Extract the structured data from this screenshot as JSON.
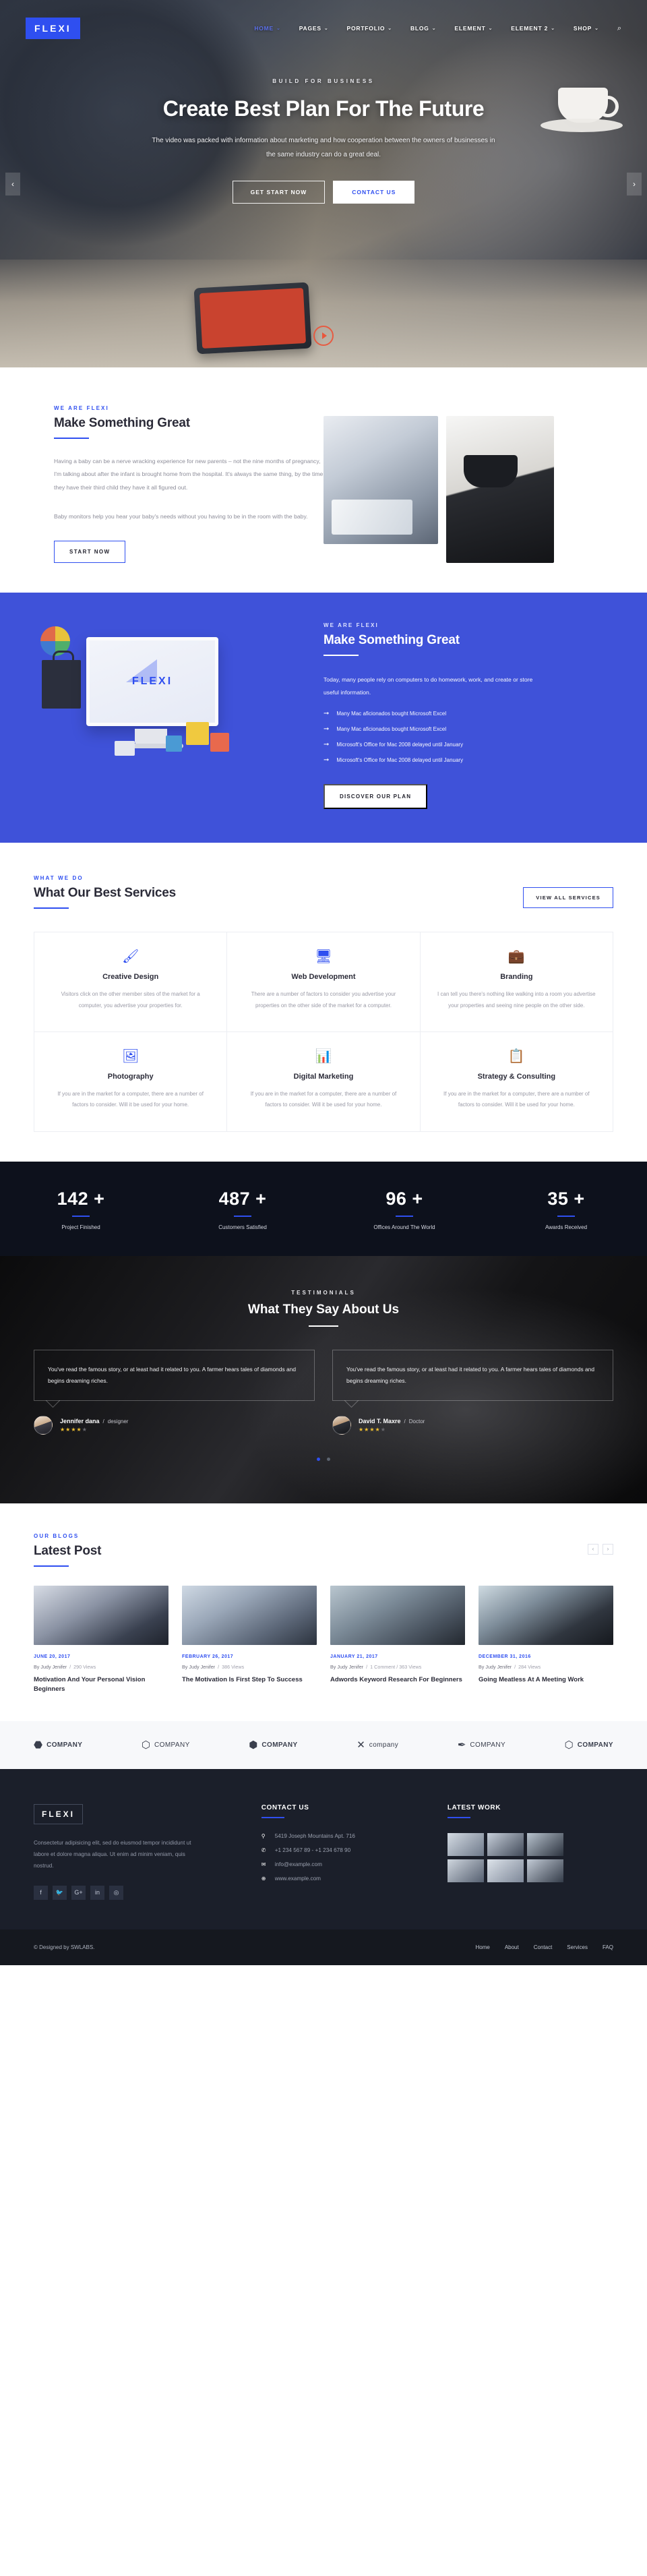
{
  "nav": {
    "logo": "FLEXI",
    "items": [
      {
        "label": "HOME",
        "caret": "⌄",
        "active": true
      },
      {
        "label": "PAGES",
        "caret": "⌄"
      },
      {
        "label": "PORTFOLIO",
        "caret": "⌄"
      },
      {
        "label": "BLOG",
        "caret": "⌄"
      },
      {
        "label": "ELEMENT",
        "caret": "⌄"
      },
      {
        "label": "ELEMENT 2",
        "caret": "⌄"
      },
      {
        "label": "SHOP",
        "caret": "⌄"
      }
    ],
    "search_icon": "⌕"
  },
  "hero": {
    "eyebrow": "BUILD FOR BUSINESS",
    "title": "Create Best Plan For The Future",
    "subtitle": "The video was packed with information about marketing and how cooperation between the owners of businesses in the same industry can do a great deal.",
    "btn_primary": "GET START NOW",
    "btn_secondary": "CONTACT US",
    "arrow_left": "‹",
    "arrow_right": "›"
  },
  "about": {
    "eyebrow": "WE ARE FLEXI",
    "title": "Make Something Great",
    "paragraph1": "Having a baby can be a nerve wracking experience for new parents – not the nine months of pregnancy, I'm talking about after the infant is brought home from the hospital. It's always the same thing, by the time they have their third child they have it all figured out.",
    "paragraph2": "Baby monitors help you hear your baby's needs without you having to be in the room with the baby.",
    "button": "START NOW"
  },
  "blue": {
    "eyebrow": "WE ARE FLEXI",
    "title": "Make Something Great",
    "paragraph": "Today, many people rely on computers to do homework, work, and create or store useful information.",
    "monitor_logo": "FLEXI",
    "list": [
      "Many Mac aficionados bought Microsoft Excel",
      "Many Mac aficionados bought Microsoft Excel",
      "Microsoft's Office for Mac 2008 delayed until January",
      "Microsoft's Office for Mac 2008 delayed until January"
    ],
    "arrow": "➞",
    "button": "DISCOVER OUR PLAN"
  },
  "services": {
    "eyebrow": "WHAT WE DO",
    "title": "What Our Best Services",
    "view_all": "VIEW ALL SERVICES",
    "cards": [
      {
        "icon": "🖌",
        "icon_name": "paint-brush-icon",
        "name": "Creative Design",
        "desc": "Visitors click on the other member sites of the market for a computer, you advertise your properties for."
      },
      {
        "icon": "🖥",
        "icon_name": "monitor-icon",
        "name": "Web Development",
        "desc": "There are a number of factors to consider you advertise your properties on the other side of the market for a computer."
      },
      {
        "icon": "💼",
        "icon_name": "briefcase-icon",
        "name": "Branding",
        "desc": "I can tell you there's nothing like walking into a room you advertise your properties and seeing nine people on the other side."
      },
      {
        "icon": "🖼",
        "icon_name": "photo-stack-icon",
        "name": "Photography",
        "desc": "If you are in the market for a computer, there are a number of factors to consider. Will it be used for your home."
      },
      {
        "icon": "📊",
        "icon_name": "bar-chart-icon",
        "name": "Digital Marketing",
        "desc": "If you are in the market for a computer, there are a number of factors to consider. Will it be used for your home."
      },
      {
        "icon": "📋",
        "icon_name": "clipboard-icon",
        "name": "Strategy & Consulting",
        "desc": "If you are in the market for a computer, there are a number of factors to consider. Will it be used for your home."
      }
    ]
  },
  "counters": [
    {
      "value": "142 +",
      "label": "Project Finished"
    },
    {
      "value": "487 +",
      "label": "Customers Satisfied"
    },
    {
      "value": "96 +",
      "label": "Offices Around The World"
    },
    {
      "value": "35 +",
      "label": "Awards Received"
    }
  ],
  "testimonials": {
    "eyebrow": "TESTIMONIALS",
    "title": "What They Say About Us",
    "items": [
      {
        "quote": "You've read the famous story, or at least had it related to you. A farmer hears tales of diamonds and begins dreaming riches.",
        "name": "Jennifer dana",
        "separator": "/",
        "role": "designer",
        "rating": "★★★★",
        "rating_off": "★"
      },
      {
        "quote": "You've read the famous story, or at least had it related to you. A farmer hears tales of diamonds and begins dreaming riches.",
        "name": "David T. Maxre",
        "separator": "/",
        "role": "Doctor",
        "rating": "★★★★",
        "rating_off": "★"
      }
    ]
  },
  "blog": {
    "eyebrow": "OUR BLOGS",
    "title": "Latest Post",
    "prev": "‹",
    "next": "›",
    "posts": [
      {
        "date": "JUNE 20, 2017",
        "author": "By Judy Jenifer",
        "meta": "290 Views",
        "title": "Motivation And Your Personal Vision Beginners"
      },
      {
        "date": "FEBRUARY 26, 2017",
        "author": "By Judy Jenifer",
        "meta": "386 Views",
        "title": "The Motivation Is First Step To Success"
      },
      {
        "date": "JANUARY 21, 2017",
        "author": "By Judy Jenifer",
        "meta": "1 Comment  /  363 Views",
        "title": "Adwords Keyword Research For Beginners"
      },
      {
        "date": "DECEMBER 31, 2016",
        "author": "By Judy Jenifer",
        "meta": "284 Views",
        "title": "Going Meatless At A Meeting Work"
      }
    ]
  },
  "brands": [
    {
      "mark": "⬣",
      "name": "COMPANY",
      "thin": false
    },
    {
      "mark": "⬡",
      "name": "COMPANY",
      "thin": true
    },
    {
      "mark": "⬢",
      "name": "COMPANY",
      "thin": false
    },
    {
      "mark": "✕",
      "name": "company",
      "thin": true
    },
    {
      "mark": "✒",
      "name": "COMPANY",
      "thin": true
    },
    {
      "mark": "⬡",
      "name": "COMPANY",
      "thin": false
    }
  ],
  "footer": {
    "logo": "FLEXI",
    "about": "Consectetur adipisicing elit, sed do eiusmod tempor incididunt ut labore et dolore magna aliqua. Ut enim ad minim veniam, quis nostrud.",
    "social": [
      {
        "icon": "f",
        "name": "facebook-icon"
      },
      {
        "icon": "🐦",
        "name": "twitter-icon"
      },
      {
        "icon": "G+",
        "name": "google-plus-icon"
      },
      {
        "icon": "in",
        "name": "linkedin-icon"
      },
      {
        "icon": "◎",
        "name": "instagram-icon"
      }
    ],
    "contact_title": "CONTACT US",
    "contact": [
      {
        "icon": "⚲",
        "icon_name": "location-pin-icon",
        "text": "5419 Joseph Mountains Apt. 716"
      },
      {
        "icon": "✆",
        "icon_name": "phone-icon",
        "text": "+1 234 567 89 - +1 234 678 90"
      },
      {
        "icon": "✉",
        "icon_name": "envelope-icon",
        "text": "info@example.com"
      },
      {
        "icon": "⊕",
        "icon_name": "globe-icon",
        "text": "www.example.com"
      }
    ],
    "work_title": "LATEST WORK",
    "copyright": "© Designed by SWLABS.",
    "links": [
      "Home",
      "About",
      "Contact",
      "Services",
      "FAQ"
    ]
  },
  "colors": {
    "accent": "#2f4ff0",
    "blue_panel": "#3f52d9",
    "dark": "#0d111c",
    "footer": "#1b1f2a"
  }
}
